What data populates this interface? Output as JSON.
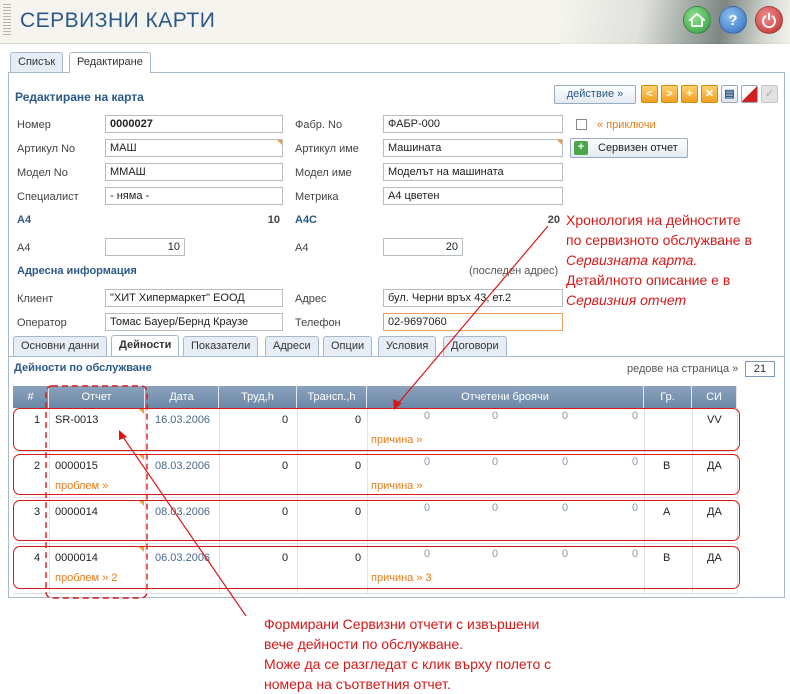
{
  "app": {
    "title": "СЕРВИЗНИ КАРТИ"
  },
  "top_tabs": [
    "Списък",
    "Редактиране"
  ],
  "card": {
    "title": "Редактиране на карта",
    "action_label": "действие »",
    "close_label": "« приключи",
    "service_report_button": "Сервизен отчет",
    "fields": {
      "number_label": "Номер",
      "number": "0000027",
      "item_no_label": "Артикул No",
      "item_no": "МАШ",
      "model_no_label": "Модел No",
      "model_no": "ММАШ",
      "specialist_label": "Специалист",
      "specialist": "- няма -",
      "serial_label": "Фабр. No",
      "serial": "ФАБР-000",
      "item_name_label": "Артикул име",
      "item_name": "Машината",
      "model_name_label": "Модел име",
      "model_name": "Моделът на машината",
      "metric_label": "Метрика",
      "metric": "А4 цветен"
    },
    "a4": {
      "title": "A4",
      "total": "10",
      "label": "A4",
      "value": "10"
    },
    "a4c": {
      "title": "A4C",
      "total": "20",
      "label": "A4",
      "value": "20"
    }
  },
  "address": {
    "title": "Адресна информация",
    "last_label": "(последен адрес)",
    "client_label": "Клиент",
    "client": "\"ХИТ Хипермаркет\" ЕООД",
    "operator_label": "Оператор",
    "operator": "Томас Бауер/Бернд Краузе",
    "address_label": "Адрес",
    "address": "бул. Черни връх 43, ет.2",
    "phone_label": "Телефон",
    "phone": "02-9697060"
  },
  "sub_tabs": [
    "Основни данни",
    "Дейности",
    "Показатели",
    "Адреси",
    "Опции",
    "Условия",
    "Договори"
  ],
  "activities": {
    "title": "Дейности по обслужване",
    "rows_per_page_label": "редове на страница »",
    "rows_per_page": "21",
    "columns": [
      "#",
      "Отчет",
      "Дата",
      "Труд,h",
      "Трансп.,h",
      "Отчетени броячи",
      "Гр.",
      "СИ"
    ],
    "rows": [
      {
        "n": "1",
        "report": "SR-0013",
        "date": "16.03.2006",
        "labor": "0",
        "transport": "0",
        "counters": [
          "0",
          "0",
          "0",
          "0"
        ],
        "group": "",
        "si": "VV",
        "problem": "",
        "reason": "причина »"
      },
      {
        "n": "2",
        "report": "0000015",
        "date": "08.03.2006",
        "labor": "0",
        "transport": "0",
        "counters": [
          "0",
          "0",
          "0",
          "0"
        ],
        "group": "В",
        "si": "ДА",
        "problem": "проблем »",
        "reason": "причина »"
      },
      {
        "n": "3",
        "report": "0000014",
        "date": "08.03.2006",
        "labor": "0",
        "transport": "0",
        "counters": [
          "0",
          "0",
          "0",
          "0"
        ],
        "group": "А",
        "si": "ДА",
        "problem": "",
        "reason": ""
      },
      {
        "n": "4",
        "report": "0000014",
        "date": "06.03.2006",
        "labor": "0",
        "transport": "0",
        "counters": [
          "0",
          "0",
          "0",
          "0"
        ],
        "group": "В",
        "si": "ДА",
        "problem": "проблем » 2",
        "reason": "причина » 3"
      }
    ]
  },
  "annotations": {
    "right": [
      "Хронология на  дейностите",
      "по сервизното обслужване в",
      "Сервизната карта.",
      "Детайлното описание е в",
      "Сервизния отчет"
    ],
    "bottom": [
      "Формирани Сервизни отчети с извършени",
      "вече дейности по обслужване.",
      "Може да се разгледат с клик върху полето с",
      "номера на съответния отчет."
    ]
  },
  "colors": {
    "accent": "#2a5a8a",
    "annotation": "#d81818",
    "grid_header": "#7890ac",
    "link": "#e67d1a"
  }
}
